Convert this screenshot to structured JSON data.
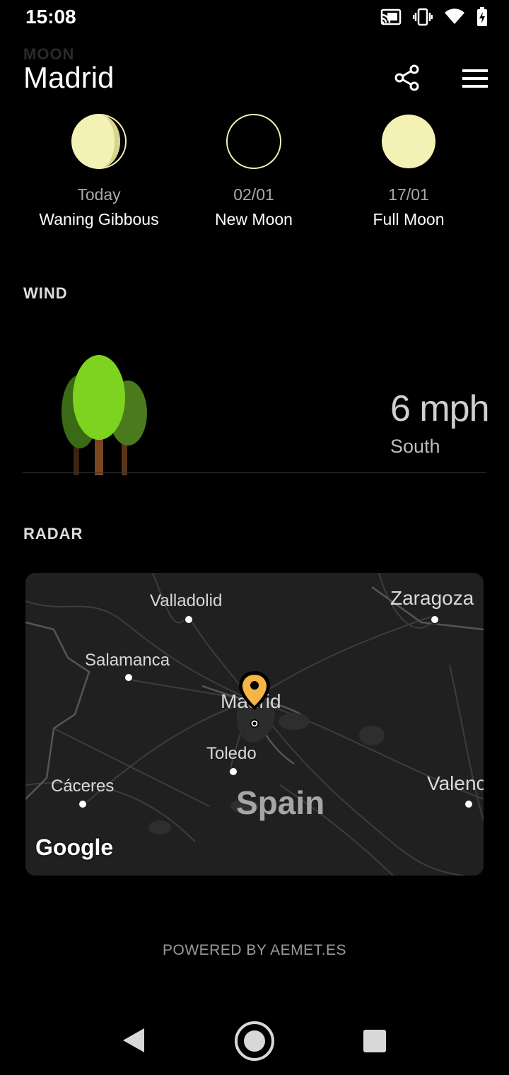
{
  "status_bar": {
    "time": "15:08",
    "icons": [
      "cast-icon",
      "vibrate-icon",
      "wifi-icon",
      "battery-charging-icon"
    ]
  },
  "header": {
    "section_label": "MOON",
    "city": "Madrid",
    "share_icon": "share-icon",
    "menu_icon": "menu-icon"
  },
  "moon": {
    "phases": [
      {
        "day": "Today",
        "name": "Waning Gibbous",
        "icon": "waning-gibbous-icon"
      },
      {
        "day": "02/01",
        "name": "New Moon",
        "icon": "new-moon-icon"
      },
      {
        "day": "17/01",
        "name": "Full Moon",
        "icon": "full-moon-icon"
      }
    ],
    "colors": {
      "moon_light": "#f4f1b4",
      "moon_shadow": "#c9c47c"
    }
  },
  "wind": {
    "title": "WIND",
    "speed": "6 mph",
    "direction": "South",
    "colors": {
      "tree_light": "#7ed321",
      "tree_dark": "#4a7a1c",
      "trunk": "#7a4620"
    }
  },
  "radar": {
    "title": "RADAR",
    "map_labels": {
      "valladolid": "Valladolid",
      "zaragoza": "Zaragoza",
      "salamanca": "Salamanca",
      "madrid": "Madrid",
      "toledo": "Toledo",
      "caceres": "Cáceres",
      "valencia": "Valenc",
      "country": "Spain"
    },
    "map_attribution": "Google",
    "pin_color": "#f5b445"
  },
  "footer": {
    "powered_by": "POWERED BY AEMET.ES"
  },
  "nav": {
    "back_icon": "back-icon",
    "home_icon": "home-icon",
    "recents_icon": "recents-icon"
  }
}
